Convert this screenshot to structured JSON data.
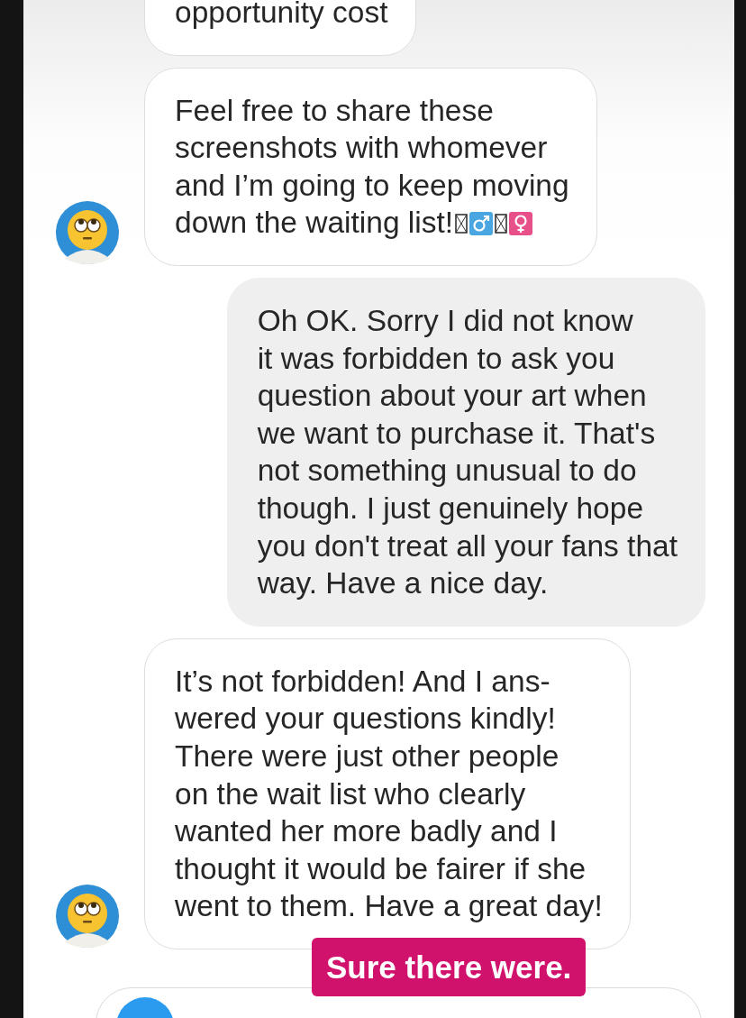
{
  "messages": [
    {
      "kind": "received",
      "avatar": false,
      "lines": [
        "opportunity cost"
      ]
    },
    {
      "kind": "received",
      "avatar": true,
      "lines": [
        "Feel free to share these",
        "screenshots with whomever",
        "and I’m going to keep moving",
        "down the waiting list!"
      ],
      "emoji_tail": true
    },
    {
      "kind": "sent",
      "lines": [
        "Oh OK. Sorry I did not know",
        "it was forbidden to ask you",
        "question about your art when",
        "we want to purchase it. That's",
        "not something unusual to do",
        "though. I just genuinely hope",
        "you don't treat all your fans that",
        "way. Have a nice day."
      ]
    },
    {
      "kind": "received",
      "avatar": true,
      "lines": [
        "It’s not forbidden! And I ans-",
        "wered your questions kindly!",
        "There were just other people",
        "on the wait list who clearly",
        "wanted her more badly and I",
        "thought it would be fairer if she",
        "went to them. Have a great day!"
      ]
    }
  ],
  "sticker": {
    "text": "Sure there were."
  }
}
